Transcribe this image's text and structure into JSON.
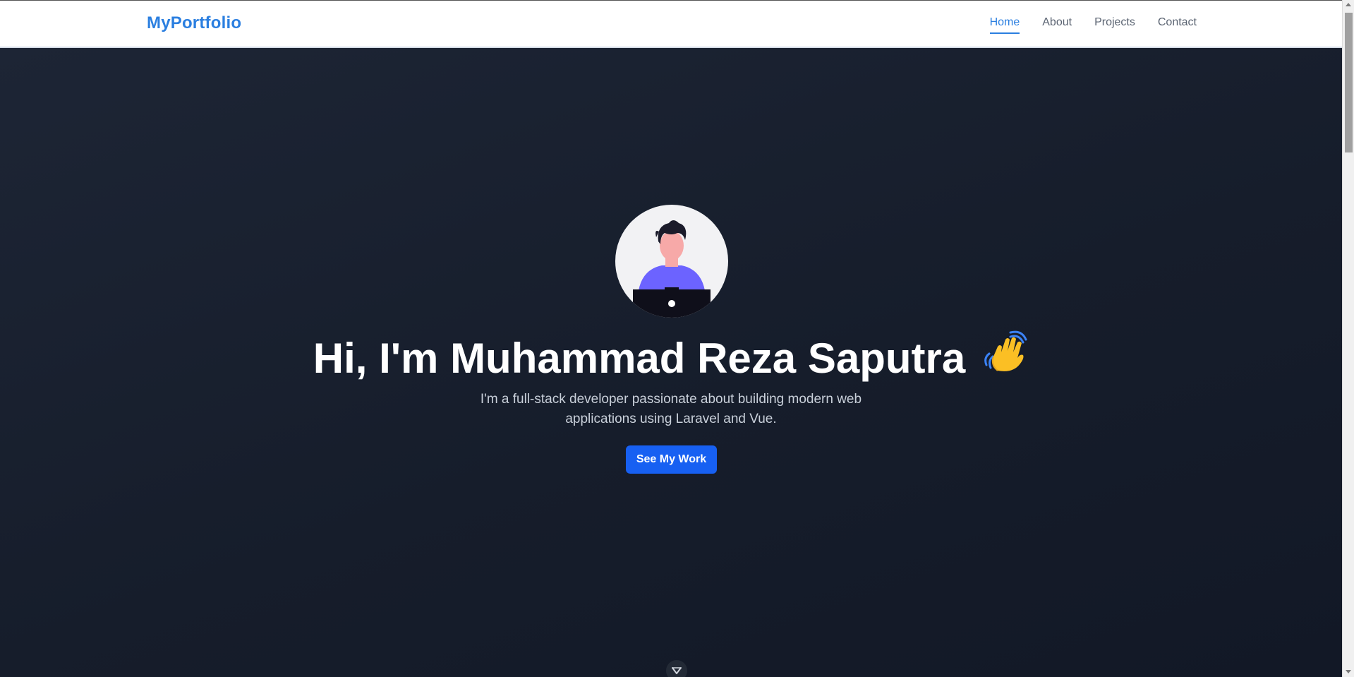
{
  "navbar": {
    "brand": "MyPortfolio",
    "links": [
      {
        "label": "Home",
        "active": true
      },
      {
        "label": "About",
        "active": false
      },
      {
        "label": "Projects",
        "active": false
      },
      {
        "label": "Contact",
        "active": false
      }
    ]
  },
  "hero": {
    "headline": "Hi, I'm Muhammad Reza Saputra",
    "tagline": "I'm a full-stack developer passionate about building modern web applications using Laravel and Vue.",
    "cta_label": "See My Work",
    "avatar_icon": "developer-avatar-icon",
    "wave_icon": "waving-hand-icon",
    "scroll_icon": "chevron-down-icon"
  },
  "colors": {
    "accent": "#2b7fe0",
    "button": "#1760f2",
    "hero_bg": "#1a2130"
  }
}
